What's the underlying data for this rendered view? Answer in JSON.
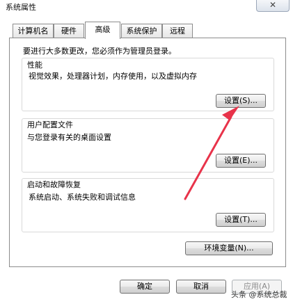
{
  "window": {
    "title": "系统属性",
    "close_symbol": "✕"
  },
  "tabs": [
    {
      "label": "计算机名"
    },
    {
      "label": "硬件"
    },
    {
      "label": "高级",
      "active": true
    },
    {
      "label": "系统保护"
    },
    {
      "label": "远程"
    }
  ],
  "notice": "要进行大多数更改，您必须作为管理员登录。",
  "performance": {
    "title": "性能",
    "description": "视觉效果，处理器计划，内存使用，以及虚拟内存",
    "button": "设置(S)..."
  },
  "user_profiles": {
    "title": "用户配置文件",
    "description": "与您登录有关的桌面设置",
    "button": "设置(E)..."
  },
  "startup_recovery": {
    "title": "启动和故障恢复",
    "description": "系统启动、系统失败和调试信息",
    "button": "设置(T)..."
  },
  "env_button": "环境变量(N)...",
  "footer": {
    "ok": "确定",
    "cancel": "取消",
    "apply": "应用(A)"
  },
  "watermark": "头条 @系统总裁",
  "colors": {
    "annotation_arrow": "#e8334a",
    "panel_border": "#8c8c8c"
  }
}
